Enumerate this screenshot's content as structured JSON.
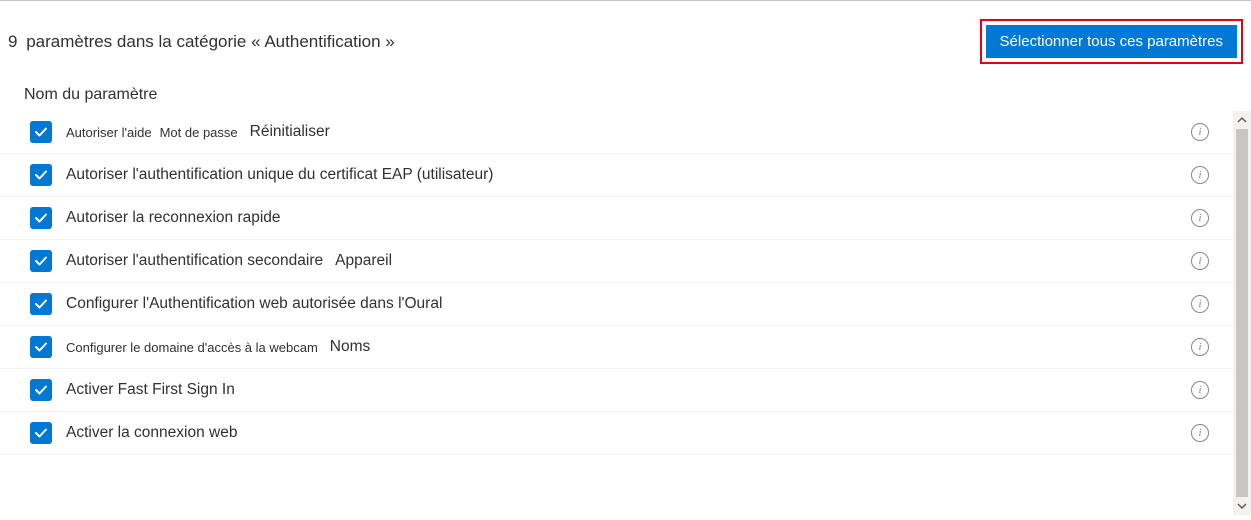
{
  "header": {
    "count": "9",
    "text": "paramètres dans la catégorie « Authentification »",
    "select_all": "Sélectionner tous ces paramètres"
  },
  "column_header": "Nom du paramètre",
  "rows": [
    {
      "label": "Autoriser l'aide",
      "label2": "Mot de passe",
      "extra": "Réinitialiser",
      "small": true
    },
    {
      "label": "Autoriser l'authentification unique du certificat EAP (utilisateur)"
    },
    {
      "label": "Autoriser la reconnexion rapide"
    },
    {
      "label": "Autoriser l'authentification secondaire",
      "extra": "Appareil"
    },
    {
      "label": "Configurer l'Authentification web autorisée dans l'Oural"
    },
    {
      "label": "Configurer le domaine d'accès à la webcam",
      "extra": "Noms",
      "small": true
    },
    {
      "label": "Activer Fast First Sign In"
    },
    {
      "label": "Activer la connexion web"
    }
  ]
}
